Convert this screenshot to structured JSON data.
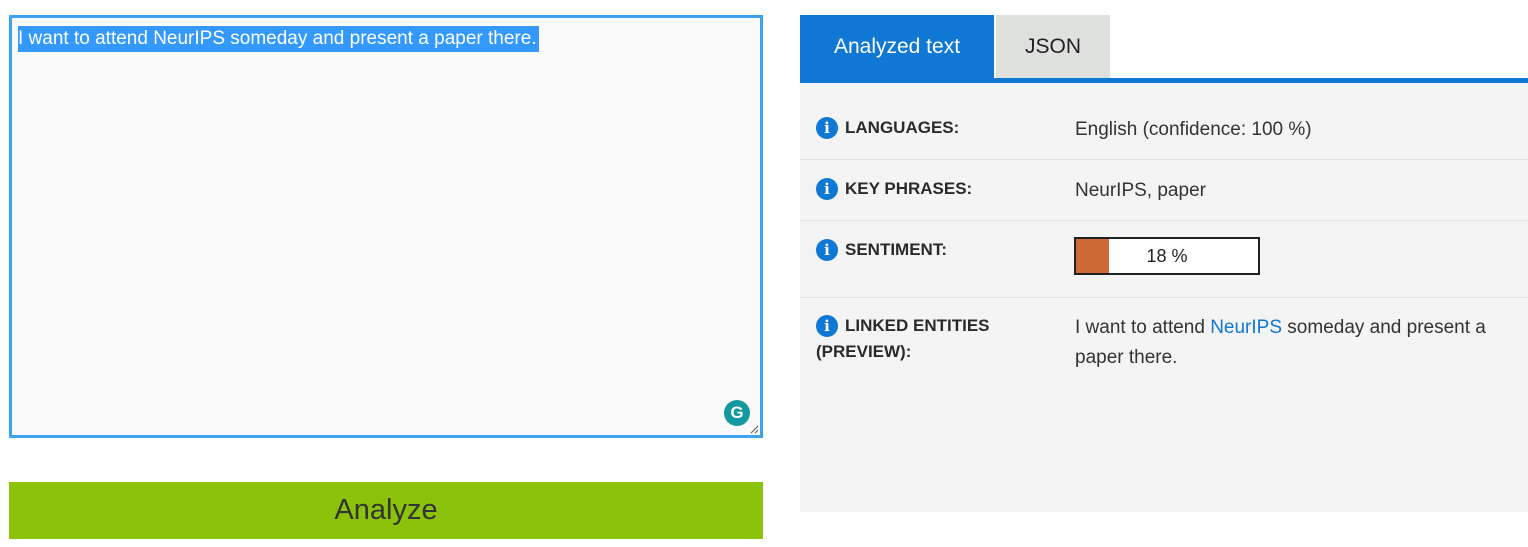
{
  "input": {
    "text": "I want to attend NeurIPS someday and present a paper there."
  },
  "grammarly_icon": "grammarly-icon",
  "analyze_button": {
    "label": "Analyze"
  },
  "tabs": [
    {
      "label": "Analyzed text",
      "active": true
    },
    {
      "label": "JSON",
      "active": false
    }
  ],
  "results": {
    "languages": {
      "label": "LANGUAGES:",
      "value": "English (confidence: 100 %)"
    },
    "key_phrases": {
      "label": "KEY PHRASES:",
      "value": "NeurIPS, paper"
    },
    "sentiment": {
      "label": "SENTIMENT:",
      "value_text": "18 %",
      "percent": 18
    },
    "linked_entities": {
      "label_line1": "LINKED ENTITIES",
      "label_line2": "(PREVIEW):",
      "text_before": "I want to attend ",
      "entity": "NeurIPS",
      "text_after": " someday and present a paper there."
    }
  },
  "colors": {
    "accent": "#0f78d4",
    "analyze_green": "#8cc20a",
    "sentiment_fill": "#cf6a36",
    "selection": "#3399ff"
  }
}
